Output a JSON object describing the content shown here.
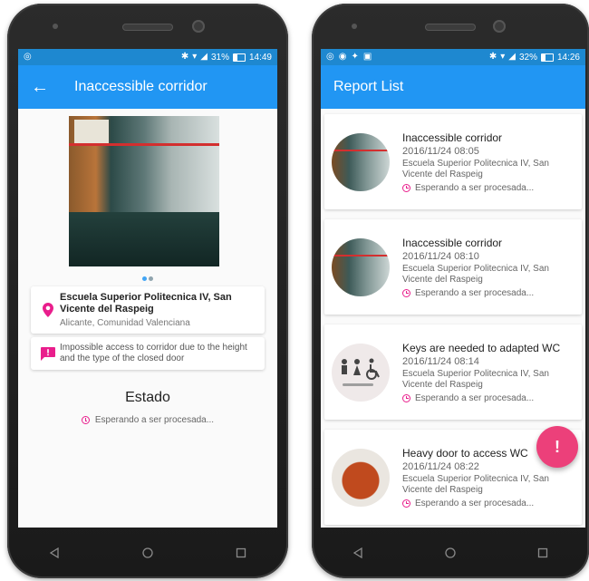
{
  "left_phone": {
    "statusbar": {
      "battery": "31%",
      "time": "14:49"
    },
    "appbar": {
      "title": "Inaccessible corridor"
    },
    "location": {
      "title": "Escuela Superior Politecnica IV, San Vicente del Raspeig",
      "subtitle": "Alicante, Comunidad Valenciana"
    },
    "description": "Impossible access to corridor due to the height and the type of the closed door",
    "estado": {
      "title": "Estado",
      "status": "Esperando a ser procesada..."
    }
  },
  "right_phone": {
    "statusbar": {
      "battery": "32%",
      "time": "14:26"
    },
    "appbar": {
      "title": "Report List"
    },
    "reports": [
      {
        "title": "Inaccessible corridor",
        "date": "2016/11/24 08:05",
        "place": "Escuela Superior Politecnica IV, San Vicente del Raspeig",
        "status": "Esperando a ser procesada..."
      },
      {
        "title": "Inaccessible corridor",
        "date": "2016/11/24 08:10",
        "place": "Escuela Superior Politecnica IV, San Vicente del Raspeig",
        "status": "Esperando a ser procesada..."
      },
      {
        "title": "Keys are needed to adapted WC",
        "date": "2016/11/24 08:14",
        "place": "Escuela Superior Politecnica IV, San Vicente del Raspeig",
        "status": "Esperando a ser procesada..."
      },
      {
        "title": "Heavy door to access WC",
        "date": "2016/11/24 08:22",
        "place": "Escuela Superior Politecnica IV, San Vicente del Raspeig",
        "status": "Esperando a ser procesada..."
      }
    ],
    "fab_label": "!"
  },
  "colors": {
    "statusbar": "#1e88d0",
    "appbar": "#2196f3",
    "accent": "#e91e8c",
    "fab": "#ec407a"
  }
}
